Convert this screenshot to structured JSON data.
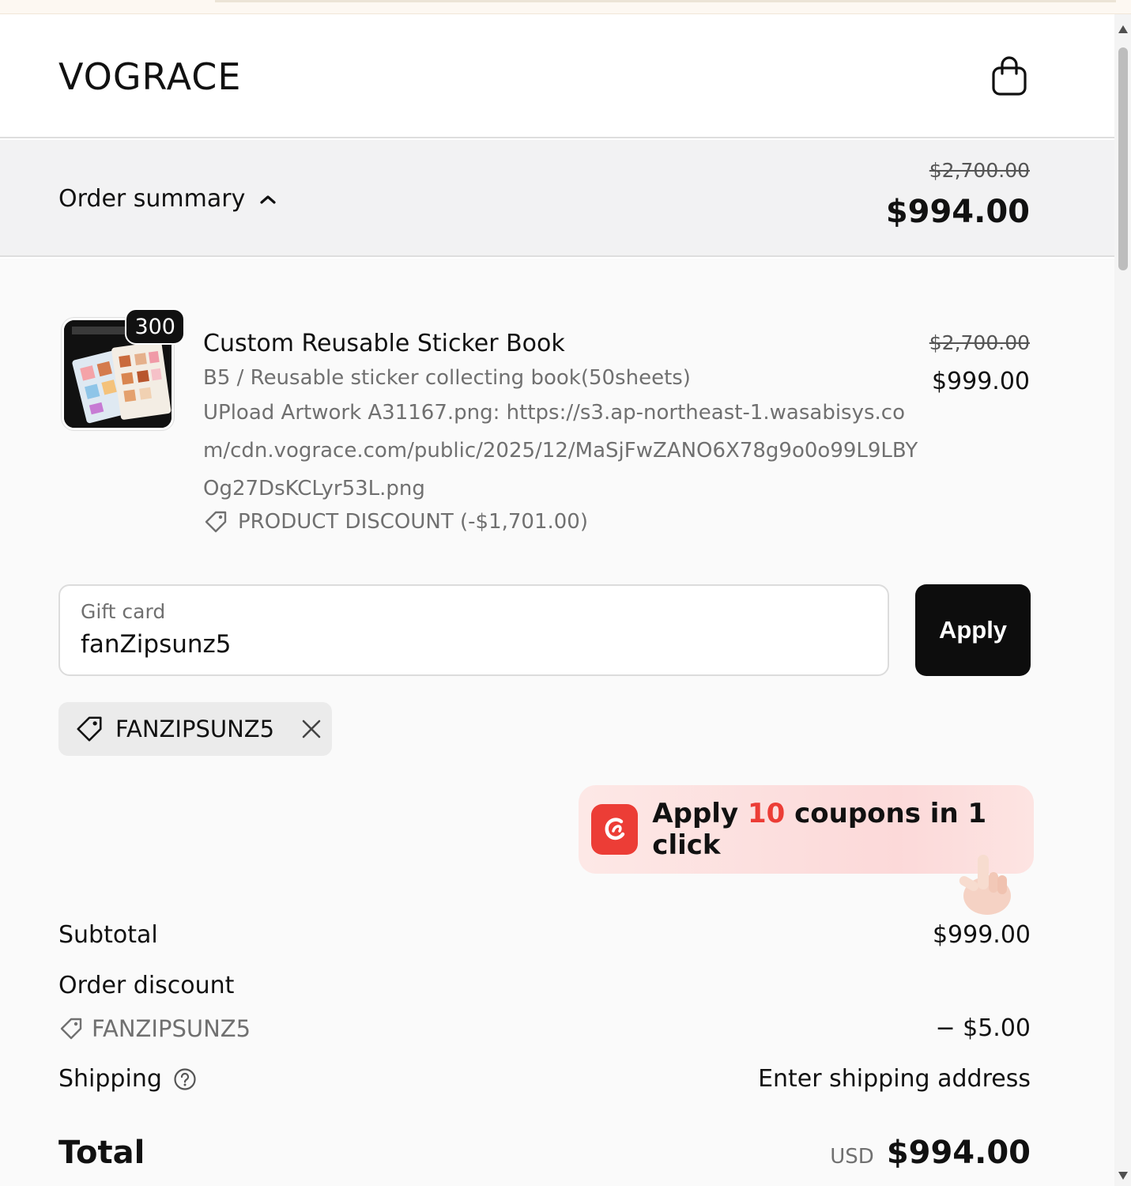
{
  "header": {
    "logo": "VOGRACE",
    "cart_icon": "shopping-bag-icon"
  },
  "summary": {
    "toggle_label": "Order summary",
    "original_total": "$2,700.00",
    "total": "$994.00"
  },
  "line_item": {
    "quantity": "300",
    "title": "Custom Reusable Sticker Book",
    "variant": "B5 / Reusable sticker collecting book(50sheets)",
    "upload_text": "UPload Artwork A31167.png: https://s3.ap-northeast-1.wasabisys.com/cdn.vograce.com/public/2025/12/MaSjFwZANO6X78g9o0o99L9LBYOg27DsKCLyr53L.png",
    "discount": "PRODUCT DISCOUNT (-$1,701.00)",
    "original_price": "$2,700.00",
    "price": "$999.00"
  },
  "gift_card": {
    "label": "Gift card",
    "value": "fanZipsunz5",
    "apply_label": "Apply"
  },
  "applied_code": {
    "code": "FANZIPSUNZ5"
  },
  "promo": {
    "prefix": "Apply ",
    "count": "10",
    "suffix": " coupons in 1 click",
    "accent": "#ec3d36"
  },
  "totals": {
    "subtotal_label": "Subtotal",
    "subtotal_value": "$999.00",
    "order_discount_label": "Order discount",
    "order_discount_code": "FANZIPSUNZ5",
    "order_discount_value": "− $5.00",
    "shipping_label": "Shipping",
    "shipping_value": "Enter shipping address",
    "total_label": "Total",
    "currency": "USD",
    "total_value": "$994.00"
  }
}
